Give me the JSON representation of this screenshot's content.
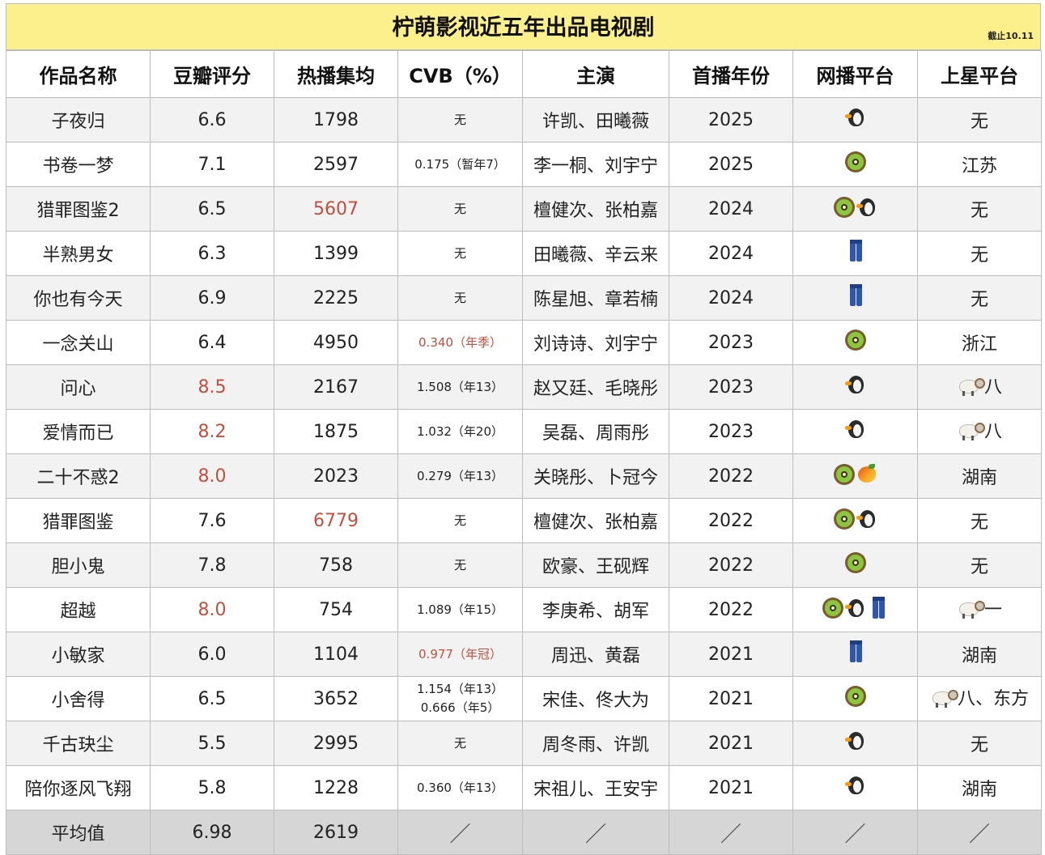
{
  "title": "柠萌影视近五年出品电视剧",
  "note": "截止10.11",
  "columns": [
    "作品名称",
    "豆瓣评分",
    "热播集均",
    "CVB（%）",
    "主演",
    "首播年份",
    "网播平台",
    "上星平台"
  ],
  "rows": [
    {
      "name": "子夜归",
      "score": "6.6",
      "avg": "1798",
      "cvb": [
        "无"
      ],
      "cast": "许凯、田曦薇",
      "year": "2025",
      "platforms": [
        "penguin-icon"
      ],
      "sat_icon": "",
      "sat": "无"
    },
    {
      "name": "书卷一梦",
      "score": "7.1",
      "avg": "2597",
      "cvb": [
        "0.175（暂年7）"
      ],
      "cast": "李一桐、刘宇宁",
      "year": "2025",
      "platforms": [
        "kiwi-icon"
      ],
      "sat_icon": "",
      "sat": "江苏"
    },
    {
      "name": "猎罪图鉴2",
      "score": "6.5",
      "avg": "5607",
      "avg_hl": true,
      "cvb": [
        "无"
      ],
      "cast": "檀健次、张柏嘉",
      "year": "2024",
      "platforms": [
        "kiwi-icon",
        "penguin-icon"
      ],
      "sat_icon": "",
      "sat": "无"
    },
    {
      "name": "半熟男女",
      "score": "6.3",
      "avg": "1399",
      "cvb": [
        "无"
      ],
      "cast": "田曦薇、辛云来",
      "year": "2024",
      "platforms": [
        "jeans-icon"
      ],
      "sat_icon": "",
      "sat": "无"
    },
    {
      "name": "你也有今天",
      "score": "6.9",
      "avg": "2225",
      "cvb": [
        "无"
      ],
      "cast": "陈星旭、章若楠",
      "year": "2024",
      "platforms": [
        "jeans-icon"
      ],
      "sat_icon": "",
      "sat": "无"
    },
    {
      "name": "一念关山",
      "score": "6.4",
      "avg": "4950",
      "cvb": [
        "0.340（年季）"
      ],
      "cvb_hl": true,
      "cast": "刘诗诗、刘宇宁",
      "year": "2023",
      "platforms": [
        "kiwi-icon"
      ],
      "sat_icon": "",
      "sat": "浙江"
    },
    {
      "name": "问心",
      "score": "8.5",
      "score_hl": true,
      "avg": "2167",
      "cvb": [
        "1.508（年13）"
      ],
      "cast": "赵又廷、毛晓彤",
      "year": "2023",
      "platforms": [
        "penguin-icon"
      ],
      "sat_icon": "ram-icon",
      "sat": "八"
    },
    {
      "name": "爱情而已",
      "score": "8.2",
      "score_hl": true,
      "avg": "1875",
      "cvb": [
        "1.032（年20）"
      ],
      "cast": "吴磊、周雨彤",
      "year": "2023",
      "platforms": [
        "penguin-icon"
      ],
      "sat_icon": "ram-icon",
      "sat": "八"
    },
    {
      "name": "二十不惑2",
      "score": "8.0",
      "score_hl": true,
      "avg": "2023",
      "cvb": [
        "0.279（年13）"
      ],
      "cast": "关晓彤、卜冠今",
      "year": "2022",
      "platforms": [
        "kiwi-icon",
        "mango-icon"
      ],
      "sat_icon": "",
      "sat": "湖南"
    },
    {
      "name": "猎罪图鉴",
      "score": "7.6",
      "avg": "6779",
      "avg_hl": true,
      "cvb": [
        "无"
      ],
      "cast": "檀健次、张柏嘉",
      "year": "2022",
      "platforms": [
        "kiwi-icon",
        "penguin-icon"
      ],
      "sat_icon": "",
      "sat": "无"
    },
    {
      "name": "胆小鬼",
      "score": "7.8",
      "avg": "758",
      "cvb": [
        "无"
      ],
      "cast": "欧豪、王砚辉",
      "year": "2022",
      "platforms": [
        "kiwi-icon"
      ],
      "sat_icon": "",
      "sat": "无"
    },
    {
      "name": "超越",
      "score": "8.0",
      "score_hl": true,
      "avg": "754",
      "cvb": [
        "1.089（年15）"
      ],
      "cast": "李庚希、胡军",
      "year": "2022",
      "platforms": [
        "kiwi-icon",
        "penguin-icon",
        "jeans-icon"
      ],
      "sat_icon": "ram-icon",
      "sat": "一"
    },
    {
      "name": "小敏家",
      "score": "6.0",
      "avg": "1104",
      "cvb": [
        "0.977（年冠）"
      ],
      "cvb_hl": true,
      "cast": "周迅、黄磊",
      "year": "2021",
      "platforms": [
        "jeans-icon"
      ],
      "sat_icon": "",
      "sat": "湖南"
    },
    {
      "name": "小舍得",
      "score": "6.5",
      "avg": "3652",
      "cvb": [
        "1.154（年13）",
        "0.666（年5）"
      ],
      "cast": "宋佳、佟大为",
      "year": "2021",
      "platforms": [
        "kiwi-icon"
      ],
      "sat_icon": "ram-icon",
      "sat": "八、东方"
    },
    {
      "name": "千古玦尘",
      "score": "5.5",
      "avg": "2995",
      "cvb": [
        "无"
      ],
      "cast": "周冬雨、许凯",
      "year": "2021",
      "platforms": [
        "penguin-icon"
      ],
      "sat_icon": "",
      "sat": "无"
    },
    {
      "name": "陪你逐风飞翔",
      "score": "5.8",
      "avg": "1228",
      "cvb": [
        "0.360（年13）"
      ],
      "cast": "宋祖儿、王安宇",
      "year": "2021",
      "platforms": [
        "penguin-icon"
      ],
      "sat_icon": "",
      "sat": "湖南"
    }
  ],
  "average": {
    "label": "平均值",
    "score": "6.98",
    "avg": "2619",
    "slash": "／"
  },
  "colors": {
    "title_bg": "#fbf08c",
    "highlight": "#c0503e",
    "stripe": "#f2f2f2",
    "avg_bg": "#d6d6d6",
    "border": "#bdbdbd"
  }
}
